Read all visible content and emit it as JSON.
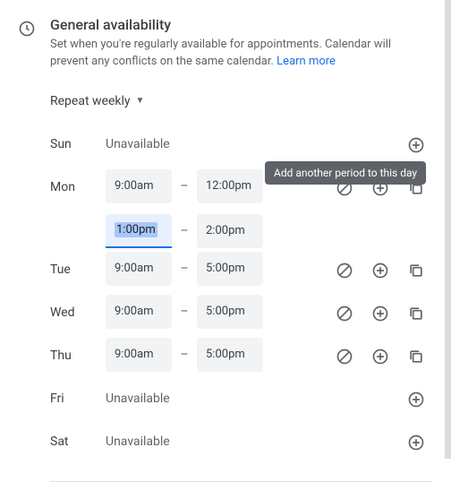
{
  "header": {
    "title": "General availability",
    "subtitle_a": "Set when you're regularly available for appointments. Calendar will prevent any conflicts on the same calendar. ",
    "learn_more": "Learn more"
  },
  "repeat": {
    "label": "Repeat weekly"
  },
  "tooltip": {
    "add_period": "Add another period to this day"
  },
  "days": [
    {
      "label": "Sun",
      "unavailable": "Unavailable",
      "periods": [],
      "actions": [
        "add"
      ]
    },
    {
      "label": "Mon",
      "periods": [
        {
          "start": "9:00am",
          "end": "12:00pm"
        },
        {
          "start": "1:00pm",
          "end": "2:00pm",
          "focused": "start"
        }
      ],
      "actions": [
        "unavailable",
        "add",
        "copy"
      ]
    },
    {
      "label": "Tue",
      "periods": [
        {
          "start": "9:00am",
          "end": "5:00pm"
        }
      ],
      "actions": [
        "unavailable",
        "add",
        "copy"
      ]
    },
    {
      "label": "Wed",
      "periods": [
        {
          "start": "9:00am",
          "end": "5:00pm"
        }
      ],
      "actions": [
        "unavailable",
        "add",
        "copy"
      ]
    },
    {
      "label": "Thu",
      "periods": [
        {
          "start": "9:00am",
          "end": "5:00pm"
        }
      ],
      "actions": [
        "unavailable",
        "add",
        "copy"
      ]
    },
    {
      "label": "Fri",
      "unavailable": "Unavailable",
      "periods": [],
      "actions": [
        "add"
      ]
    },
    {
      "label": "Sat",
      "unavailable": "Unavailable",
      "periods": [],
      "actions": [
        "add"
      ]
    }
  ]
}
